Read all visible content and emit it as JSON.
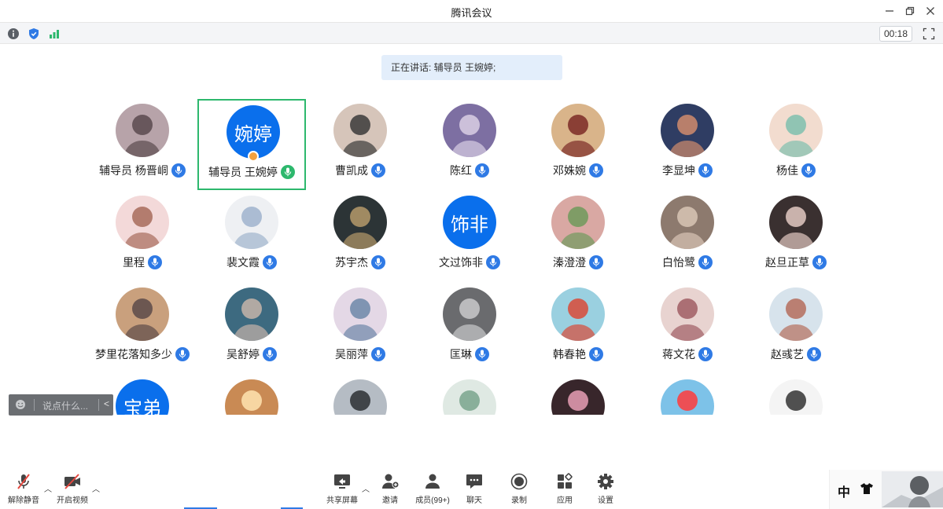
{
  "window": {
    "title": "腾讯会议"
  },
  "infobar": {
    "timer": "00:18"
  },
  "speaking": {
    "text": "正在讲话: 辅导员  王婉婷;"
  },
  "colors": {
    "accent": "#0a6fec",
    "speaking_border": "#2db86d",
    "mic": "#2f7ae5"
  },
  "participants": [
    {
      "name": "辅导员 杨晋峒",
      "avatar": "photo"
    },
    {
      "name": "辅导员  王婉婷",
      "avatar": "婉婷",
      "speaking": true,
      "host": true
    },
    {
      "name": "曹凯成",
      "avatar": "photo"
    },
    {
      "name": "陈红",
      "avatar": "photo"
    },
    {
      "name": "邓姝婉",
      "avatar": "photo"
    },
    {
      "name": "李显坤",
      "avatar": "photo"
    },
    {
      "name": "杨佳",
      "avatar": "photo"
    },
    {
      "name": "里程",
      "avatar": "photo"
    },
    {
      "name": "裴文霞",
      "avatar": "photo"
    },
    {
      "name": "苏宇杰",
      "avatar": "photo"
    },
    {
      "name": "文过饰非",
      "avatar": "饰非"
    },
    {
      "name": "溱澄澄",
      "avatar": "photo"
    },
    {
      "name": "白怡鹭",
      "avatar": "photo"
    },
    {
      "name": "赵旦正草",
      "avatar": "photo"
    },
    {
      "name": "梦里花落知多少",
      "avatar": "photo"
    },
    {
      "name": "吴舒婷",
      "avatar": "photo"
    },
    {
      "name": "吴丽萍",
      "avatar": "photo"
    },
    {
      "name": "匡琳",
      "avatar": "photo"
    },
    {
      "name": "韩春艳",
      "avatar": "photo"
    },
    {
      "name": "蒋文花",
      "avatar": "photo"
    },
    {
      "name": "赵彧艺",
      "avatar": "photo"
    },
    {
      "name": "",
      "avatar": "宝弟"
    },
    {
      "name": "",
      "avatar": "photo"
    },
    {
      "name": "",
      "avatar": "photo"
    },
    {
      "name": "",
      "avatar": "photo"
    },
    {
      "name": "",
      "avatar": "photo"
    },
    {
      "name": "",
      "avatar": "photo"
    },
    {
      "name": "",
      "avatar": "photo"
    }
  ],
  "chat": {
    "placeholder": "说点什么...",
    "collapse": "<"
  },
  "toolbar": {
    "unmute": "解除静音",
    "start_video": "开启视频",
    "share_screen": "共享屏幕",
    "invite": "邀请",
    "members": "成员(99+)",
    "chat": "聊天",
    "record": "录制",
    "apps": "应用",
    "settings": "设置"
  },
  "ime": {
    "mode": "中"
  }
}
